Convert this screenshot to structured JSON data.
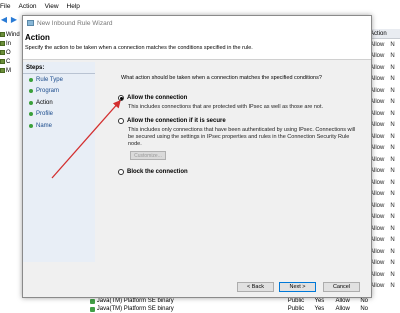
{
  "background_app": {
    "menu": [
      "File",
      "Action",
      "View",
      "Help"
    ],
    "tree": [
      "Wind",
      "In",
      "O",
      "C",
      "M"
    ],
    "right_column_header": "Action",
    "right_column_values": [
      "Allow",
      "Allow",
      "Allow",
      "Allow",
      "Allow",
      "Allow",
      "Allow",
      "Allow",
      "Allow",
      "Allow",
      "Allow",
      "Allow",
      "Allow",
      "Allow",
      "Allow",
      "Allow",
      "Allow",
      "Allow",
      "Allow",
      "Allow",
      "Allow",
      "Allow"
    ],
    "right_column_flag": "N",
    "bottom_rows": [
      {
        "name": "Java(TM) Platform SE binary",
        "profile": "Public",
        "enabled": "Yes",
        "action": "Allow",
        "flag": "No"
      },
      {
        "name": "Java(TM) Platform SE binary",
        "profile": "Public",
        "enabled": "Yes",
        "action": "Allow",
        "flag": "No"
      }
    ]
  },
  "dialog": {
    "title": "New Inbound Rule Wizard",
    "header": {
      "title": "Action",
      "description": "Specify the action to be taken when a connection matches the conditions specified in the rule."
    },
    "steps_title": "Steps:",
    "steps": [
      {
        "label": "Rule Type",
        "current": false
      },
      {
        "label": "Program",
        "current": false
      },
      {
        "label": "Action",
        "current": true
      },
      {
        "label": "Profile",
        "current": false
      },
      {
        "label": "Name",
        "current": false
      }
    ],
    "question": "What action should be taken when a connection matches the specified conditions?",
    "options": {
      "allow": {
        "label": "Allow the connection",
        "description": "This includes connections that are protected with IPsec as well as those are not.",
        "checked": true
      },
      "allow_secure": {
        "label": "Allow the connection if it is secure",
        "description": "This includes only connections that have been authenticated by using IPsec.  Connections will be secured using the settings in IPsec properties and rules in the Connection Security Rule node.",
        "customize_label": "Customize...",
        "checked": false
      },
      "block": {
        "label": "Block the connection",
        "checked": false
      }
    },
    "buttons": {
      "back": "< Back",
      "next": "Next >",
      "cancel": "Cancel"
    }
  },
  "colors": {
    "annotation_arrow": "#d32f2f",
    "steps_background": "#e8eef6",
    "dialog_background": "#f0f0f0",
    "focus_border": "#0078d7"
  }
}
